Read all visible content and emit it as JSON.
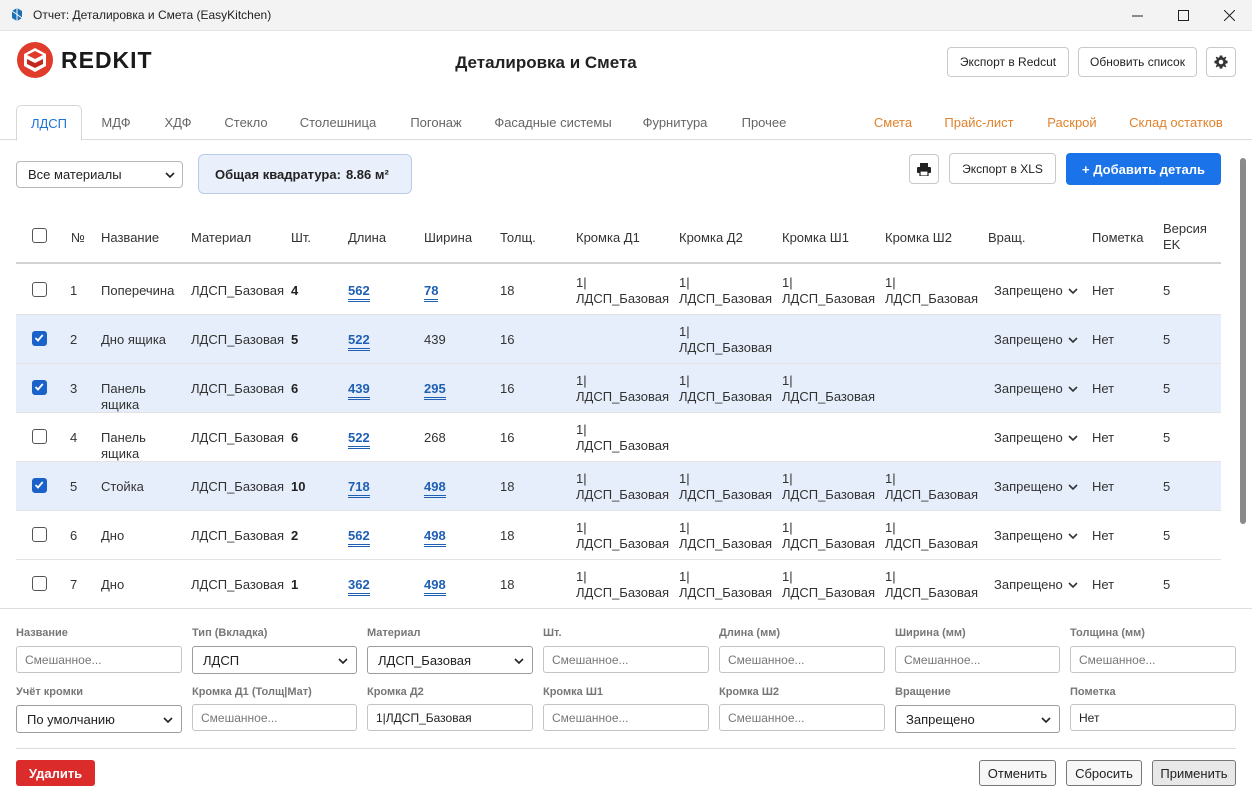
{
  "window": {
    "title": "Отчет: Деталировка и Смета (EasyKitchen)"
  },
  "header": {
    "logo_text": "REDKIT",
    "page_title": "Деталировка и Смета",
    "export_redcut": "Экспорт в Redcut",
    "refresh_list": "Обновить список"
  },
  "tabs": {
    "left": [
      "ЛДСП",
      "МДФ",
      "ХДФ",
      "Стекло",
      "Столешница",
      "Погонаж",
      "Фасадные системы",
      "Фурнитура",
      "Прочее"
    ],
    "right": [
      "Смета",
      "Прайс-лист",
      "Раскрой",
      "Склад остатков"
    ],
    "active": "ЛДСП"
  },
  "toolbar": {
    "material_filter": "Все материалы",
    "area_label": "Общая квадратура:",
    "area_value": "8.86 м²",
    "export_xls": "Экспорт в XLS",
    "add_detail": "+ Добавить деталь"
  },
  "table": {
    "headers": {
      "num": "№",
      "name": "Название",
      "material": "Материал",
      "qty": "Шт.",
      "length": "Длина",
      "width": "Ширина",
      "thick": "Толщ.",
      "edge_d1": "Кромка Д1",
      "edge_d2": "Кромка Д2",
      "edge_w1": "Кромка Ш1",
      "edge_w2": "Кромка Ш2",
      "rotation": "Вращ.",
      "note": "Пометка",
      "version": "Версия EK"
    },
    "rows": [
      {
        "checked": false,
        "num": "1",
        "name": "Поперечина",
        "material": "ЛДСП_Базовая",
        "qty": "4",
        "length": "562",
        "width": "78",
        "width_link": true,
        "thick": "18",
        "d1": "1|ЛДСП_Базовая",
        "d2": "1|ЛДСП_Базовая",
        "w1": "1|ЛДСП_Базовая",
        "w2": "1|ЛДСП_Базовая",
        "rotation": "Запрещено",
        "note": "Нет",
        "version": "5"
      },
      {
        "checked": true,
        "num": "2",
        "name": "Дно ящика",
        "material": "ЛДСП_Базовая",
        "qty": "5",
        "length": "522",
        "width": "439",
        "width_link": false,
        "thick": "16",
        "d1": "",
        "d2": "1|ЛДСП_Базовая",
        "w1": "",
        "w2": "",
        "rotation": "Запрещено",
        "note": "Нет",
        "version": "5"
      },
      {
        "checked": true,
        "num": "3",
        "name": "Панель ящика",
        "material": "ЛДСП_Базовая",
        "qty": "6",
        "length": "439",
        "width": "295",
        "width_link": true,
        "thick": "16",
        "d1": "1|ЛДСП_Базовая",
        "d2": "1|ЛДСП_Базовая",
        "w1": "1|ЛДСП_Базовая",
        "w2": "",
        "rotation": "Запрещено",
        "note": "Нет",
        "version": "5"
      },
      {
        "checked": false,
        "num": "4",
        "name": "Панель ящика",
        "material": "ЛДСП_Базовая",
        "qty": "6",
        "length": "522",
        "width": "268",
        "width_link": false,
        "thick": "16",
        "d1": "1|ЛДСП_Базовая",
        "d2": "",
        "w1": "",
        "w2": "",
        "rotation": "Запрещено",
        "note": "Нет",
        "version": "5"
      },
      {
        "checked": true,
        "num": "5",
        "name": "Стойка",
        "material": "ЛДСП_Базовая",
        "qty": "10",
        "length": "718",
        "width": "498",
        "width_link": true,
        "thick": "18",
        "d1": "1|ЛДСП_Базовая",
        "d2": "1|ЛДСП_Базовая",
        "w1": "1|ЛДСП_Базовая",
        "w2": "1|ЛДСП_Базовая",
        "rotation": "Запрещено",
        "note": "Нет",
        "version": "5"
      },
      {
        "checked": false,
        "num": "6",
        "name": "Дно",
        "material": "ЛДСП_Базовая",
        "qty": "2",
        "length": "562",
        "width": "498",
        "width_link": true,
        "thick": "18",
        "d1": "1|ЛДСП_Базовая",
        "d2": "1|ЛДСП_Базовая",
        "w1": "1|ЛДСП_Базовая",
        "w2": "1|ЛДСП_Базовая",
        "rotation": "Запрещено",
        "note": "Нет",
        "version": "5"
      },
      {
        "checked": false,
        "num": "7",
        "name": "Дно",
        "material": "ЛДСП_Базовая",
        "qty": "1",
        "length": "362",
        "width": "498",
        "width_link": true,
        "thick": "18",
        "d1": "1|ЛДСП_Базовая",
        "d2": "1|ЛДСП_Базовая",
        "w1": "1|ЛДСП_Базовая",
        "w2": "1|ЛДСП_Базовая",
        "rotation": "Запрещено",
        "note": "Нет",
        "version": "5"
      }
    ]
  },
  "form": {
    "name_label": "Название",
    "name_placeholder": "Смешанное...",
    "type_label": "Тип (Вкладка)",
    "type_value": "ЛДСП",
    "material_label": "Материал",
    "material_value": "ЛДСП_Базовая",
    "qty_label": "Шт.",
    "qty_placeholder": "Смешанное...",
    "length_label": "Длина (мм)",
    "length_placeholder": "Смешанное...",
    "width_label": "Ширина (мм)",
    "width_placeholder": "Смешанное...",
    "thick_label": "Толщина (мм)",
    "thick_placeholder": "Смешанное...",
    "edge_mode_label": "Учёт кромки",
    "edge_mode_value": "По умолчанию",
    "d1_label": "Кромка Д1 (Толщ|Мат)",
    "d1_placeholder": "Смешанное...",
    "d2_label": "Кромка Д2",
    "d2_value": "1|ЛДСП_Базовая",
    "w1_label": "Кромка Ш1",
    "w1_placeholder": "Смешанное...",
    "w2_label": "Кромка Ш2",
    "w2_placeholder": "Смешанное...",
    "rotation_label": "Вращение",
    "rotation_value": "Запрещено",
    "note_label": "Пометка",
    "note_value": "Нет",
    "delete": "Удалить",
    "cancel": "Отменить",
    "reset": "Сбросить",
    "apply": "Применить"
  },
  "colors": {
    "accent": "#1a73e8",
    "orange_tab": "#e0822d",
    "danger": "#dc2b2b",
    "selected_row": "#e6eefb"
  }
}
